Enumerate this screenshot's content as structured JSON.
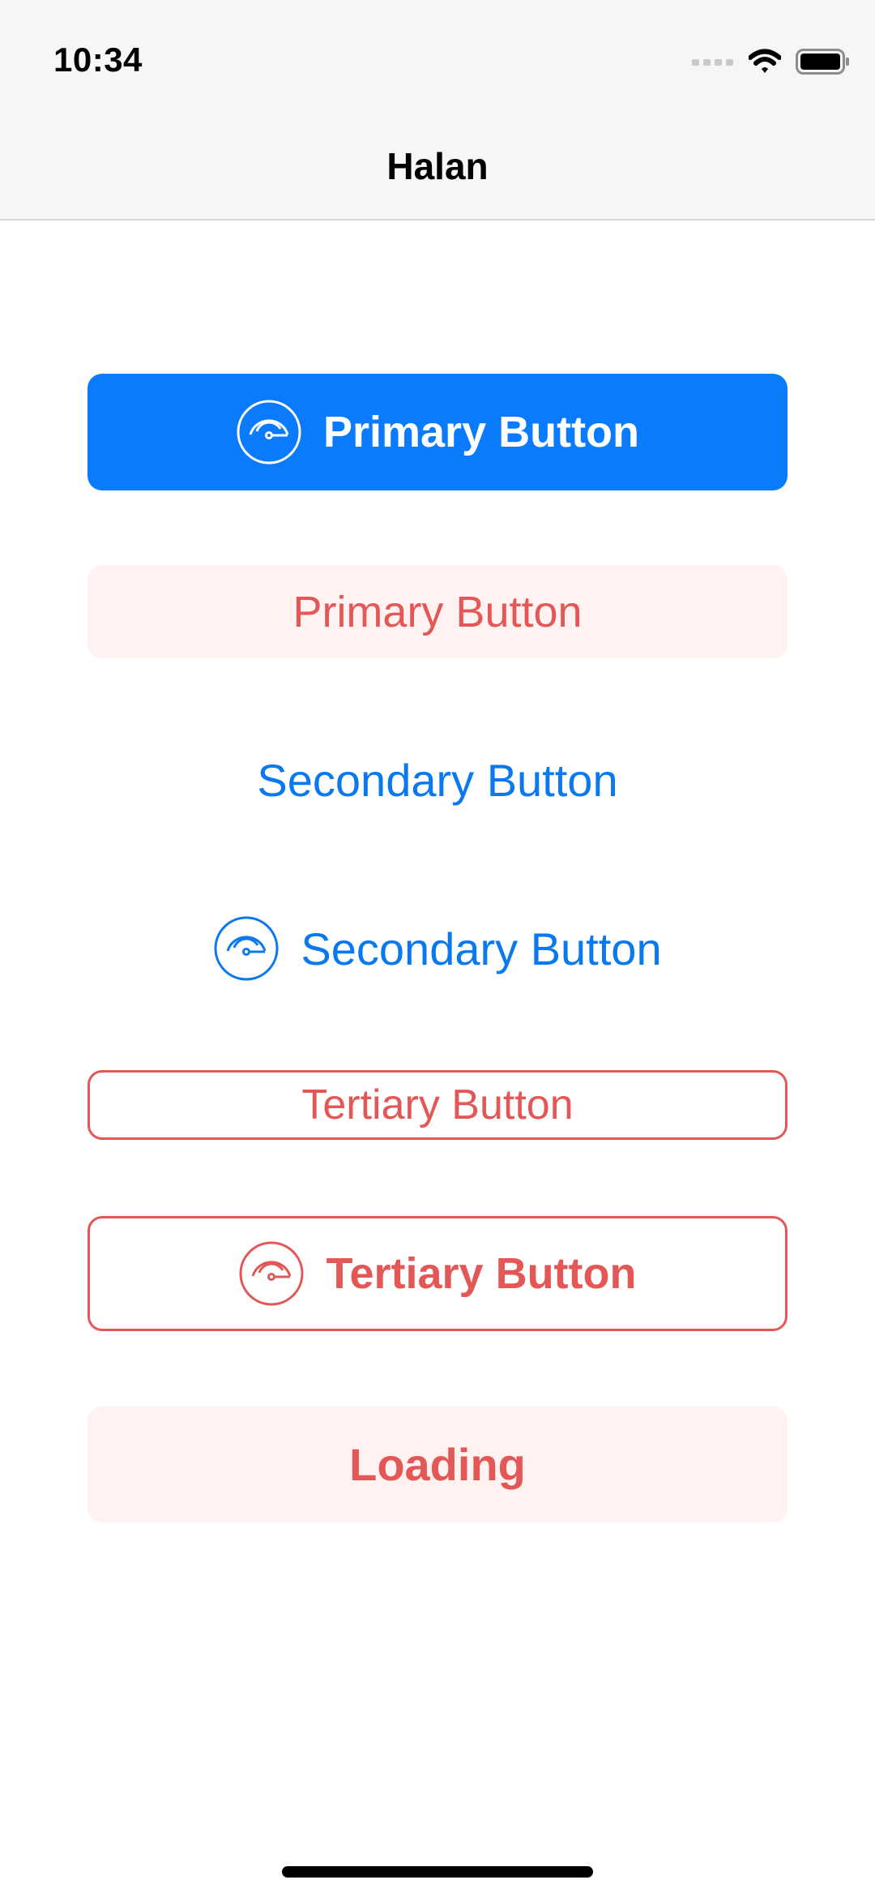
{
  "status_bar": {
    "time": "10:34",
    "icons": [
      "cellular-signal-icon",
      "wifi-icon",
      "battery-icon"
    ]
  },
  "nav": {
    "title": "Halan"
  },
  "buttons": {
    "primary_filled": {
      "label": "Primary Button",
      "icon": "speedometer-icon"
    },
    "primary_soft": {
      "label": "Primary Button"
    },
    "secondary_text": {
      "label": "Secondary Button"
    },
    "secondary_icon": {
      "label": "Secondary Button",
      "icon": "speedometer-icon"
    },
    "tertiary_outline": {
      "label": "Tertiary Button"
    },
    "tertiary_icon": {
      "label": "Tertiary Button",
      "icon": "speedometer-icon"
    },
    "loading": {
      "label": "Loading"
    }
  },
  "colors": {
    "primary_blue": "#0a7bfd",
    "secondary_blue": "#0a78ee",
    "accent_red": "#e35757",
    "soft_red_bg": "#fff2f1",
    "nav_bg": "#f7f6f6"
  }
}
